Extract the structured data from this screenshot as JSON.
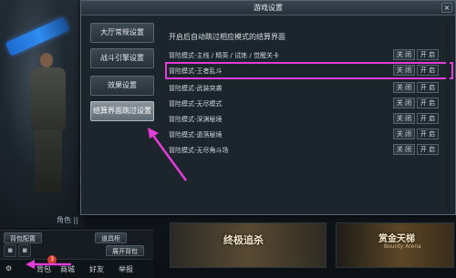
{
  "modal": {
    "title": "游戏设置",
    "close_glyph": "×",
    "nav": [
      "大厅常规设置",
      "战斗引擎设置",
      "效果设置",
      "结算界面跳过设置"
    ],
    "description": "开启后自动跳过相应模式的结算界面",
    "rows": [
      {
        "label": "冒险模式-主线 / 精英 / 试炼 / 觉醒关卡",
        "off": "关 闭",
        "on": "开 启"
      },
      {
        "label": "冒险模式-王者乱斗",
        "off": "关 闭",
        "on": "开 启"
      },
      {
        "label": "冒险模式-武装突袭",
        "off": "关 闭",
        "on": "开 启"
      },
      {
        "label": "冒险模式-无尽模式",
        "off": "关 闭",
        "on": "开 启"
      },
      {
        "label": "冒险模式-深渊秘境",
        "off": "关 闭",
        "on": "开 启"
      },
      {
        "label": "冒险模式-遗落秘境",
        "off": "关 闭",
        "on": "开 启"
      },
      {
        "label": "冒险模式-无尽角斗场",
        "off": "关 闭",
        "on": "开 启"
      }
    ]
  },
  "background": {
    "char_label": "角色 ||",
    "toolbar": {
      "backpack": "背包配置",
      "weapon_store": "道具柜",
      "open_bag": "展开背包"
    },
    "status": {
      "bag": "背包",
      "badge": "3",
      "mall": "商城",
      "friends": "好友",
      "report": "举报"
    },
    "banners": [
      {
        "title": "终极追杀",
        "sub": ""
      },
      {
        "title": "赏金天梯",
        "sub": "Bounty Arena"
      }
    ]
  },
  "colors": {
    "highlight": "#e43cd9",
    "arrow": "#e43cd9"
  }
}
